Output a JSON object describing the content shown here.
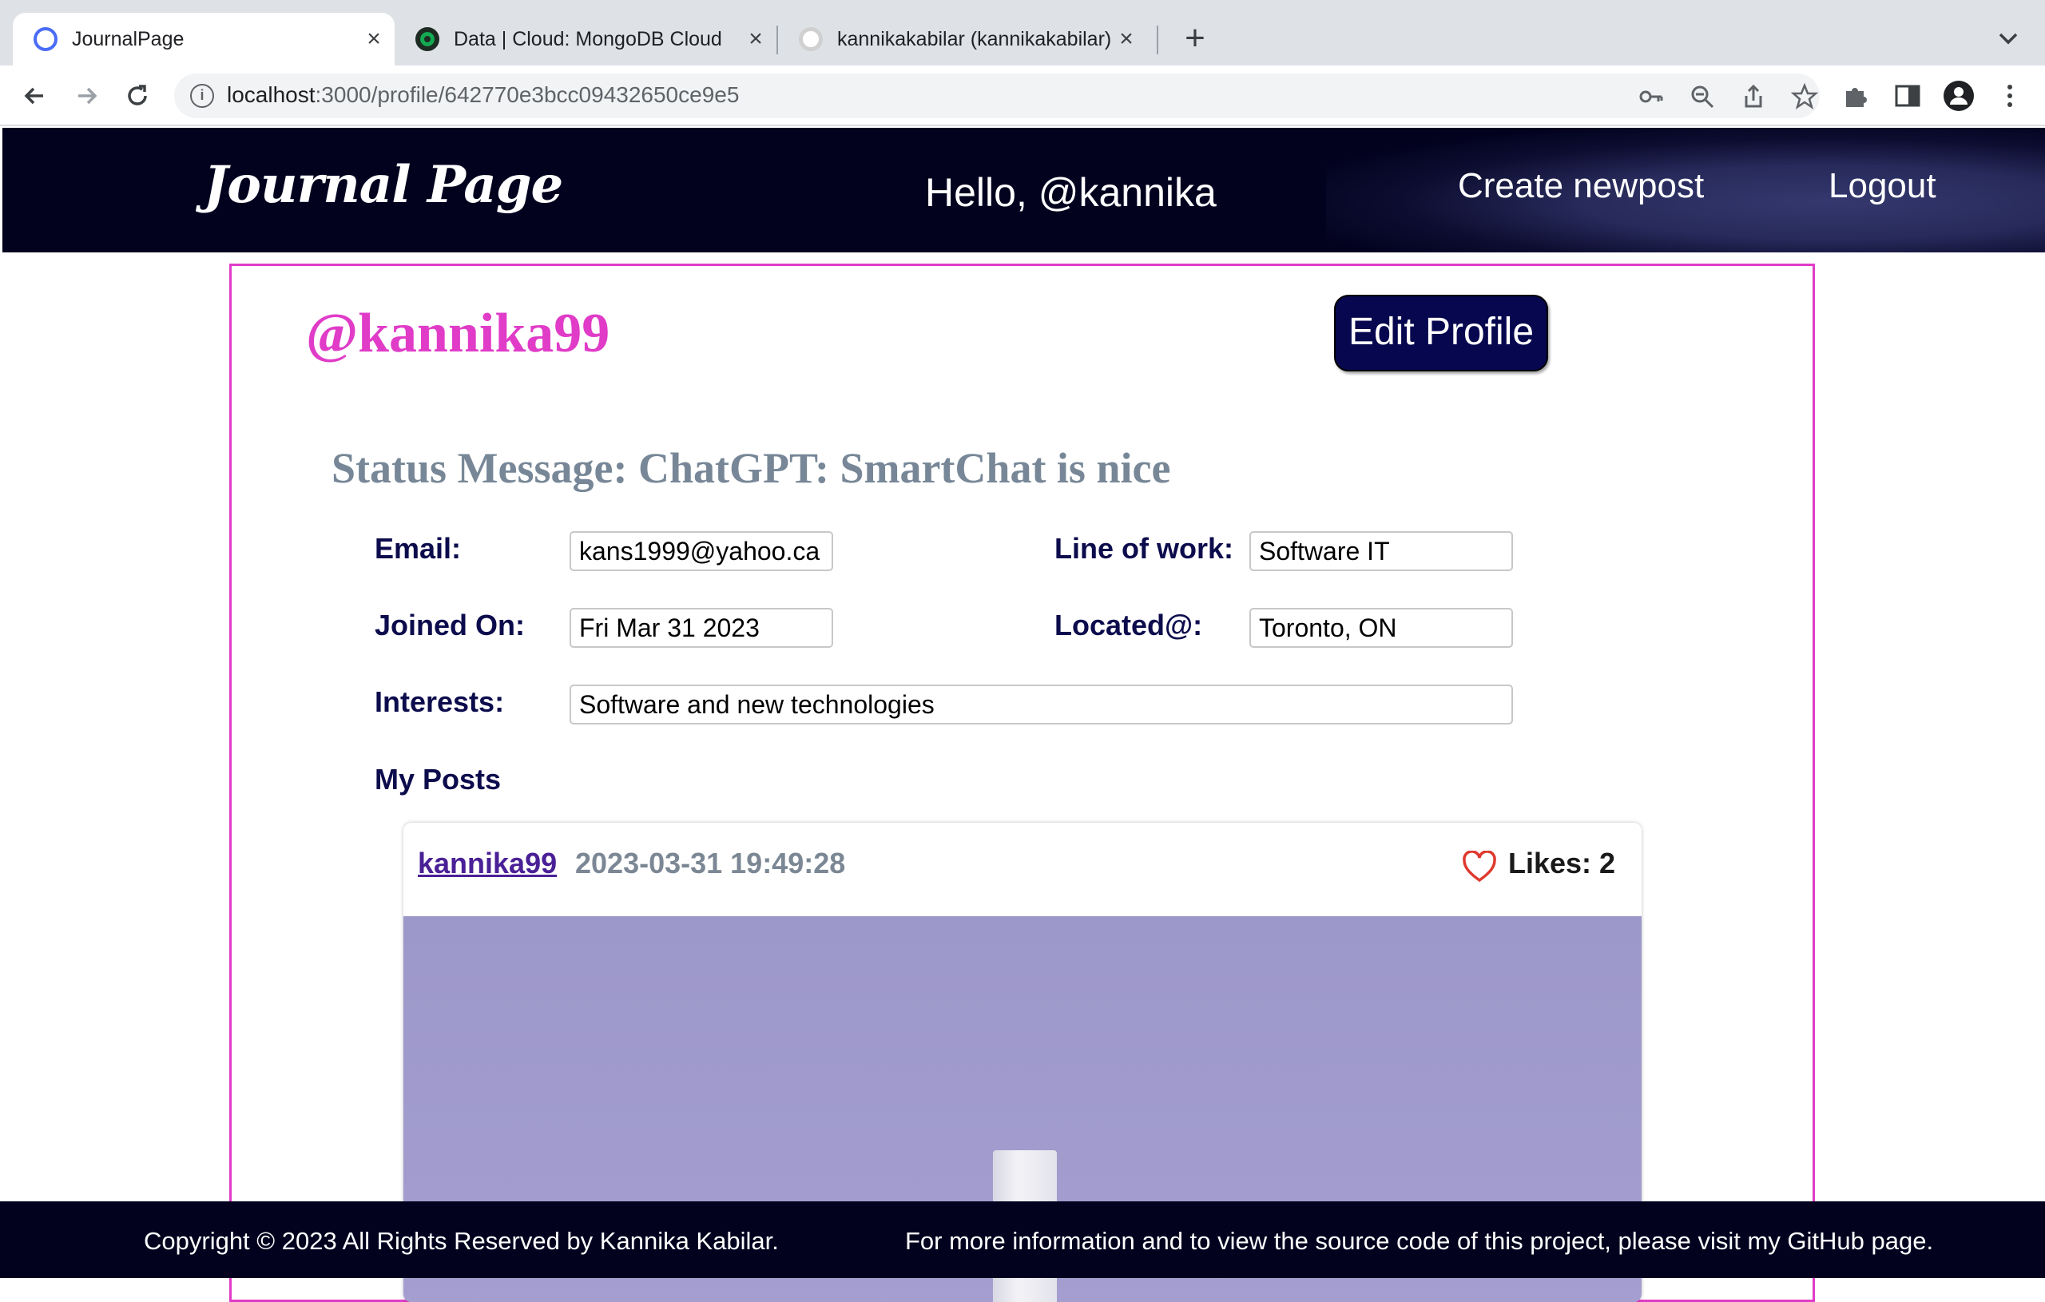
{
  "browser": {
    "tabs": [
      {
        "title": "JournalPage",
        "icon": "journalpage-favicon",
        "color": "#4a6cf7",
        "active": true
      },
      {
        "title": "Data | Cloud: MongoDB Cloud",
        "icon": "mongodb-leaf-icon",
        "color": "#13aa52",
        "active": false
      },
      {
        "title": "kannikakabilar (kannikakabilar)",
        "icon": "github-icon",
        "color": "#e8e8e8",
        "active": false
      }
    ],
    "new_tab_label": "+",
    "url_host": "localhost",
    "url_rest": ":3000/profile/642770e3bcc09432650ce9e5"
  },
  "header": {
    "logo": "Journal Page",
    "greeting": "Hello, @kannika",
    "create_link": "Create newpost",
    "logout_link": "Logout"
  },
  "profile": {
    "username": "@kannika99",
    "edit_button": "Edit Profile",
    "status": "Status Message: ChatGPT: SmartChat is nice",
    "fields": {
      "email_label": "Email:",
      "email_value": "kans1999@yahoo.ca",
      "work_label": "Line of work:",
      "work_value": "Software IT",
      "joined_label": "Joined On:",
      "joined_value": "Fri Mar 31 2023",
      "located_label": "Located@:",
      "located_value": "Toronto, ON",
      "interests_label": "Interests:",
      "interests_value": "Software and new technologies"
    },
    "my_posts_heading": "My Posts"
  },
  "post": {
    "author": "kannika99",
    "timestamp": "2023-03-31 19:49:28",
    "likes": "Likes: 2",
    "heart_color": "#e0392f"
  },
  "footer": {
    "copyright": "Copyright © 2023 All Rights Reserved by Kannika Kabilar.",
    "more_info": "For more information and to view the source code of this project, please visit my GitHub page."
  },
  "colors": {
    "accent_pink": "#e03cc8",
    "navy": "#02021f",
    "button_navy": "#07074f",
    "label_navy": "#0c0c4d",
    "status_gray": "#778797"
  }
}
